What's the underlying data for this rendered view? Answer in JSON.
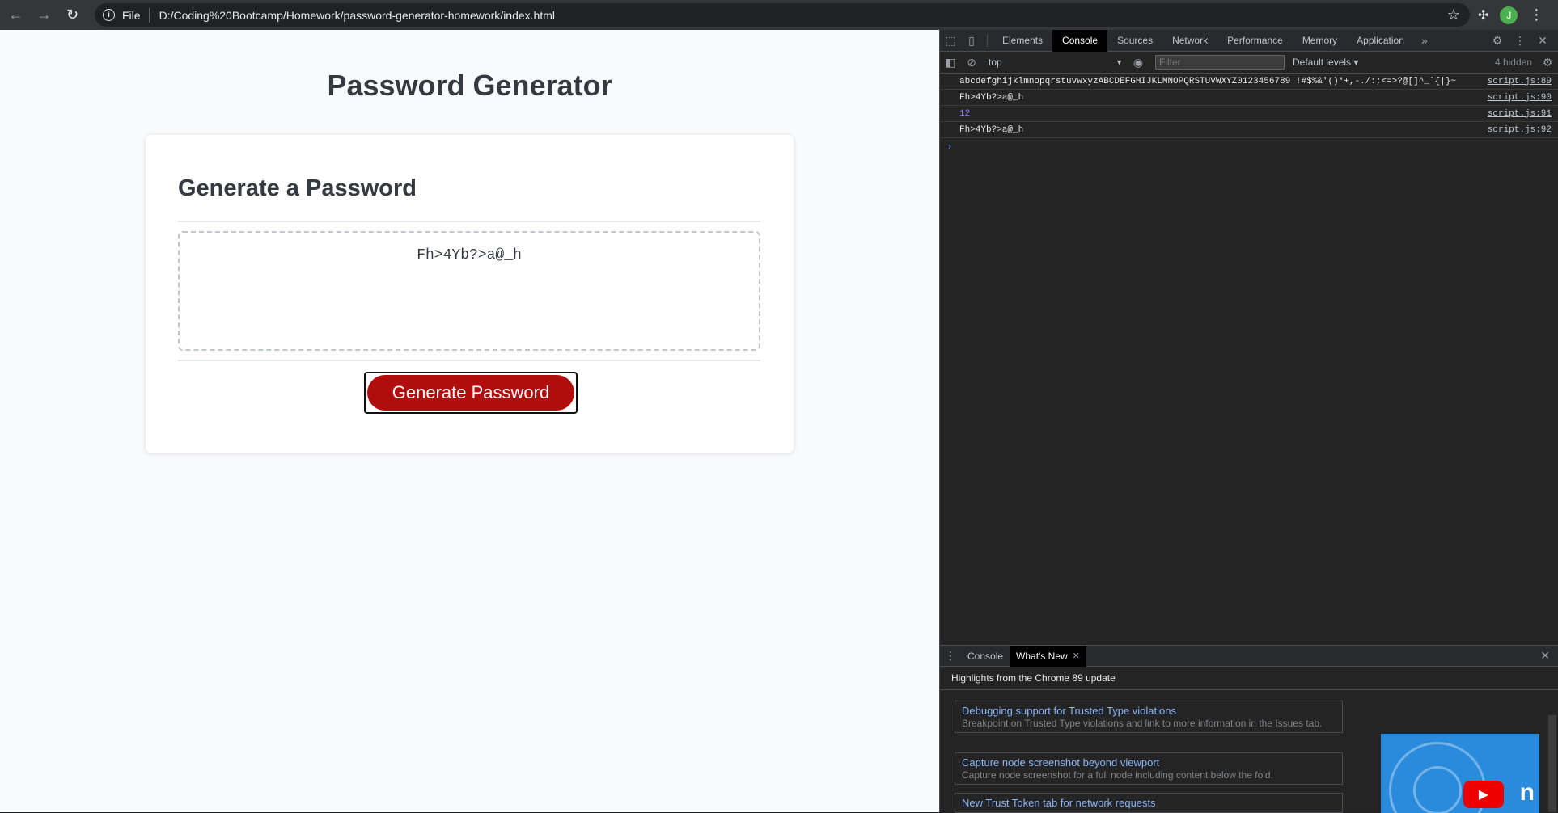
{
  "browser": {
    "url_scheme": "File",
    "url": "D:/Coding%20Bootcamp/Homework/password-generator-homework/index.html",
    "profile_initial": "J"
  },
  "page": {
    "title": "Password Generator",
    "card_title": "Generate a Password",
    "password": "Fh>4Yb?>a@_h",
    "button_label": "Generate Password",
    "button_color": "#b10d0d"
  },
  "devtools": {
    "tabs": [
      "Elements",
      "Console",
      "Sources",
      "Network",
      "Performance",
      "Memory",
      "Application"
    ],
    "active_tab": "Console",
    "context": "top",
    "filter_placeholder": "Filter",
    "levels": "Default levels ▾",
    "hidden": "4 hidden",
    "console_rows": [
      {
        "msg": "abcdefghijklmnopqrstuvwxyzABCDEFGHIJKLMNOPQRSTUVWXYZ0123456789 !#$%&'()*+,-./:;<=>?@[]^_`{|}~",
        "src": "script.js:89"
      },
      {
        "msg": "Fh>4Yb?>a@_h",
        "src": "script.js:90"
      },
      {
        "msg": "12",
        "src": "script.js:91"
      },
      {
        "msg": "Fh>4Yb?>a@_h",
        "src": "script.js:92"
      }
    ],
    "drawer": {
      "tabs": [
        "Console",
        "What's New"
      ],
      "heading": "Highlights from the Chrome 89 update",
      "items": [
        {
          "title": "Debugging support for Trusted Type violations",
          "desc": "Breakpoint on Trusted Type violations and link to more information in the Issues tab."
        },
        {
          "title": "Capture node screenshot beyond viewport",
          "desc": "Capture node screenshot for a full node including content below the fold."
        },
        {
          "title": "New Trust Token tab for network requests",
          "desc": ""
        }
      ],
      "thumb_letter": "n"
    }
  }
}
